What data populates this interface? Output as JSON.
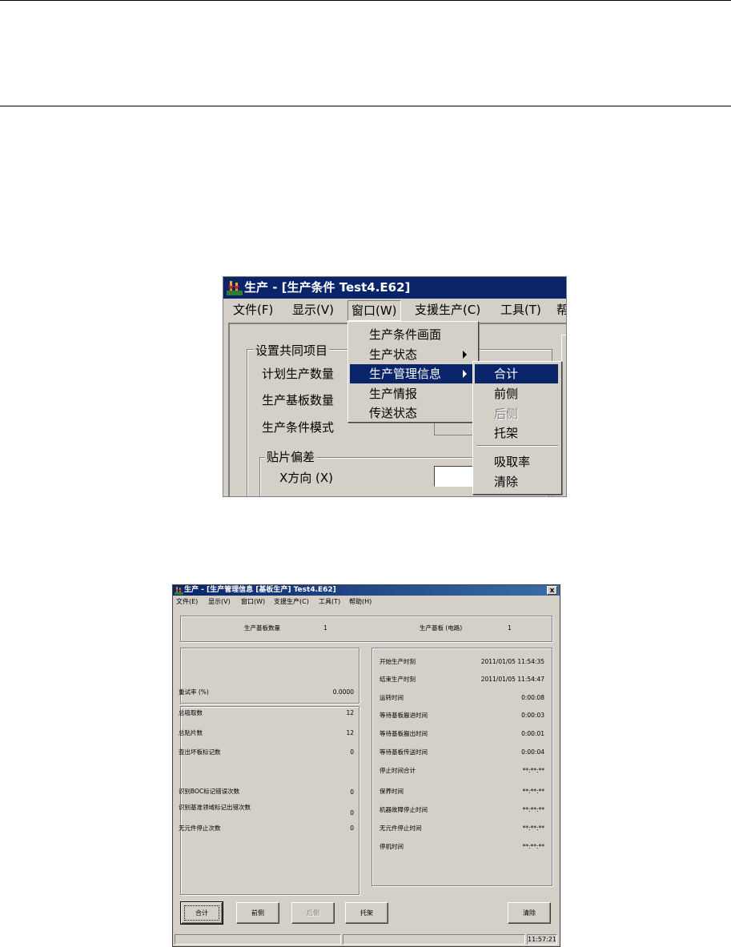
{
  "shot1": {
    "window_title": "生产 - [生产条件 Test4.E62]",
    "menu": [
      "文件(F)",
      "显示(V)",
      "窗口(W)",
      "支援生产(C)",
      "工具(T)",
      "帮"
    ],
    "group_common": "设置共同项目",
    "labels": [
      "计划生产数量",
      "生产基板数量",
      "生产条件模式"
    ],
    "group_offset": "贴片偏差",
    "x_direction": "X方向 (X)",
    "window_menu_items": [
      "生产条件画面",
      "生产状态",
      "生产管理信息",
      "生产情报",
      "传送状态"
    ],
    "submenu_items": [
      "合计",
      "前侧",
      "后侧",
      "托架",
      "吸取率",
      "清除"
    ]
  },
  "shot2": {
    "window_title": "生产 - [生产管理信息 [基板生产] Test4.E62]",
    "close": "x",
    "menu": [
      "文件(E)",
      "显示(V)",
      "窗口(W)",
      "支援生产(C)",
      "工具(T)",
      "帮助(H)"
    ],
    "top": {
      "board_count_label": "生产基板数量",
      "board_count_value": "1",
      "board_circuit_label": "生产基板 (电路)",
      "board_circuit_value": "1"
    },
    "retry": {
      "label": "重试率 (%)",
      "value": "0.0000"
    },
    "counts": [
      {
        "label": "总吸取数",
        "value": "12"
      },
      {
        "label": "总贴片数",
        "value": "12"
      },
      {
        "label": "查出坏板标记数",
        "value": "0"
      },
      {
        "label": "识别BOC标记错误次数",
        "value": "0"
      },
      {
        "label": "识别基准领域标记出错次数",
        "value": "0"
      },
      {
        "label": "无元件停止次数",
        "value": "0"
      }
    ],
    "times": [
      {
        "label": "开始生产时刻",
        "value": "2011/01/05 11:54:35"
      },
      {
        "label": "结束生产时刻",
        "value": "2011/01/05 11:54:47"
      },
      {
        "label": "运转时间",
        "value": "0:00:08"
      },
      {
        "label": "等待基板搬进时间",
        "value": "0:00:03"
      },
      {
        "label": "等待基板搬出时间",
        "value": "0:00:01"
      },
      {
        "label": "等待基板传送时间",
        "value": "0:00:04"
      },
      {
        "label": "停止时间合计",
        "value": "**:**:**"
      },
      {
        "label": "保养时间",
        "value": "**:**:**"
      },
      {
        "label": "机器故障停止时间",
        "value": "**:**:**"
      },
      {
        "label": "无元件停止时间",
        "value": "**:**:**"
      },
      {
        "label": "停机时间",
        "value": "**:**:**"
      }
    ],
    "buttons": {
      "total": "合计",
      "front": "前侧",
      "rear": "后侧",
      "tray": "托架",
      "clear": "清除"
    },
    "status_time": "11:57:21"
  }
}
